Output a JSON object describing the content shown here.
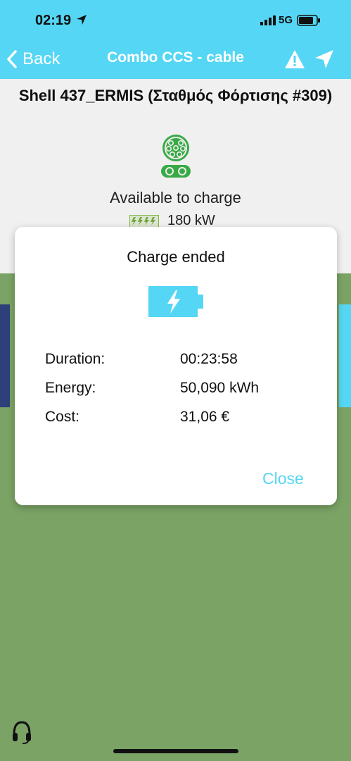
{
  "status_bar": {
    "time": "02:19",
    "network": "5G"
  },
  "nav": {
    "back_label": "Back",
    "title": "Combo CCS - cable"
  },
  "station": {
    "title": "Shell 437_ERMIS (Σταθμός Φόρτισης #309)",
    "availability": "Available to charge",
    "power": "180 kW"
  },
  "dialog": {
    "title": "Charge ended",
    "rows": [
      {
        "label": "Duration:",
        "value": "00:23:58"
      },
      {
        "label": "Energy:",
        "value": "50,090 kWh"
      },
      {
        "label": "Cost:",
        "value": "31,06 €"
      }
    ],
    "close_label": "Close"
  },
  "colors": {
    "accent": "#55d6f4",
    "map_green": "#7aa365",
    "connector_green": "#3cb54a",
    "side_blue": "#2f3f7a"
  },
  "icons": [
    "location-arrow-icon",
    "signal-icon",
    "battery-icon",
    "chevron-left-icon",
    "warning-icon",
    "navigate-icon",
    "ccs-connector-icon",
    "power-bolts-icon",
    "charging-battery-icon",
    "headset-icon"
  ]
}
